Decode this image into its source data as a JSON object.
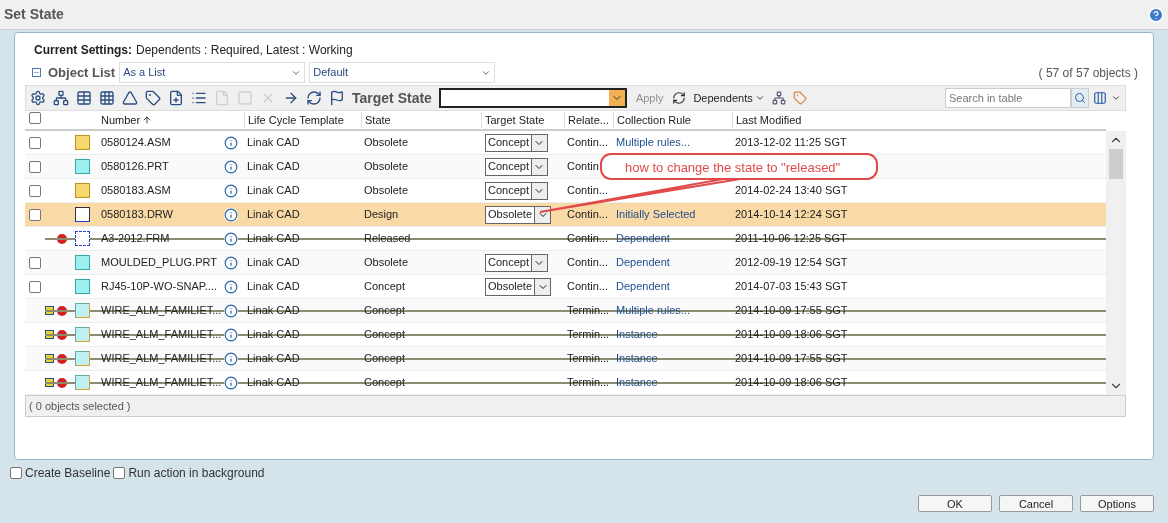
{
  "window": {
    "title": "Set State"
  },
  "current_settings": {
    "label": "Current Settings:",
    "value": "Dependents : Required, Latest : Working"
  },
  "object_list": {
    "title": "Object List",
    "expanded": true,
    "view": "As a List",
    "filter": "Default",
    "count": "( 57 of 57 objects )"
  },
  "toolbar": {
    "tools": [
      {
        "kind": "gear",
        "disabled": false
      },
      {
        "kind": "tree",
        "disabled": false
      },
      {
        "kind": "add-table",
        "disabled": false
      },
      {
        "kind": "add-grid",
        "disabled": false
      },
      {
        "kind": "triangle",
        "disabled": false
      },
      {
        "kind": "add-tag",
        "disabled": false
      },
      {
        "kind": "add-file",
        "disabled": false
      },
      {
        "kind": "list",
        "disabled": false
      },
      {
        "kind": "file",
        "disabled": true
      },
      {
        "kind": "frame",
        "disabled": true
      },
      {
        "kind": "remove",
        "disabled": true
      },
      {
        "kind": "arrow",
        "disabled": false
      },
      {
        "kind": "refresh-table",
        "disabled": false
      },
      {
        "kind": "flag",
        "disabled": false
      }
    ],
    "target_state_label": "Target State",
    "apply": {
      "label": "Apply",
      "disabled": true
    },
    "dependents": "Dependents",
    "search": {
      "placeholder": "Search in table"
    }
  },
  "table": {
    "select_all": {
      "checked": false
    },
    "columns": [
      "Number",
      "Life Cycle Template",
      "State",
      "Target State",
      "Relate...",
      "Collection Rule",
      "Last Modified"
    ],
    "rows": [
      {
        "kind": "assembly",
        "number": "0580124.ASM",
        "template": "Linak CAD",
        "state": "Obsolete",
        "target_state": "Concept",
        "related": "Contin...",
        "rule": "Multiple rules...",
        "modified": "2013-12-02 11:25 SGT",
        "checked": false,
        "selected": false,
        "struck": false,
        "flagged": false
      },
      {
        "kind": "part",
        "number": "0580126.PRT",
        "template": "Linak CAD",
        "state": "Obsolete",
        "target_state": "Concept",
        "related": "Contin",
        "checked": false,
        "selected": false,
        "struck": false,
        "flagged": false
      },
      {
        "kind": "assembly",
        "number": "0580183.ASM",
        "template": "Linak CAD",
        "state": "Obsolete",
        "target_state": "Concept",
        "related": "Contin...",
        "modified": "2014-02-24 13:40 SGT",
        "checked": false,
        "selected": false,
        "struck": false,
        "flagged": false
      },
      {
        "kind": "drawing",
        "number": "0580183.DRW",
        "template": "Linak CAD",
        "state": "Design",
        "target_state": "Obsolete",
        "related": "Contin...",
        "rule": "Initially Selected",
        "modified": "2014-10-14 12:24 SGT",
        "checked": false,
        "selected": true,
        "struck": false,
        "flagged": false
      },
      {
        "kind": "format",
        "number": "A3-2012.FRM",
        "template": "Linak CAD",
        "state": "Released",
        "related": "Contin...",
        "rule": "Dependent",
        "modified": "2011-10-06 12:25 SGT",
        "selected": false,
        "struck": true,
        "flagged": false
      },
      {
        "kind": "part",
        "number": "MOULDED_PLUG.PRT",
        "template": "Linak CAD",
        "state": "Obsolete",
        "target_state": "Concept",
        "related": "Contin...",
        "rule": "Dependent",
        "modified": "2012-09-19 12:54 SGT",
        "checked": false,
        "selected": false,
        "struck": false,
        "flagged": false
      },
      {
        "kind": "part",
        "number": "RJ45-10P-WO-SNAP....",
        "template": "Linak CAD",
        "state": "Concept",
        "target_state": "Obsolete",
        "related": "Contin...",
        "rule": "Dependent",
        "modified": "2014-07-03 15:43 SGT",
        "checked": false,
        "selected": false,
        "struck": false,
        "flagged": false
      },
      {
        "kind": "family",
        "number": "WIRE_ALM_FAMILIET...",
        "template": "Linak CAD",
        "state": "Concept",
        "related": "Termin...",
        "rule": "Multiple rules...",
        "modified": "2014-10-09 17:55 SGT",
        "selected": false,
        "struck": true,
        "flagged": true
      },
      {
        "kind": "family",
        "number": "WIRE_ALM_FAMILIET...",
        "template": "Linak CAD",
        "state": "Concept",
        "related": "Termin...",
        "rule": "Instance",
        "modified": "2014-10-09 18:06 SGT",
        "selected": false,
        "struck": true,
        "flagged": true
      },
      {
        "kind": "family",
        "number": "WIRE_ALM_FAMILIET...",
        "template": "Linak CAD",
        "state": "Concept",
        "related": "Termin...",
        "rule": "Instance",
        "modified": "2014-10-09 17:55 SGT",
        "selected": false,
        "struck": true,
        "flagged": true
      },
      {
        "kind": "family",
        "number": "WIRE_ALM_FAMILIET...",
        "template": "Linak CAD",
        "state": "Concept",
        "related": "Termin...",
        "rule": "Instance",
        "modified": "2014-10-09 18:06 SGT",
        "selected": false,
        "struck": true,
        "flagged": true
      }
    ],
    "footer": "( 0 objects selected )"
  },
  "callout": "how to change the state to \"released\"",
  "options": [
    {
      "label": "Create Baseline",
      "checked": false
    },
    {
      "label": "Run action in background",
      "checked": false
    }
  ],
  "buttons": [
    "OK",
    "Cancel",
    "Options"
  ]
}
